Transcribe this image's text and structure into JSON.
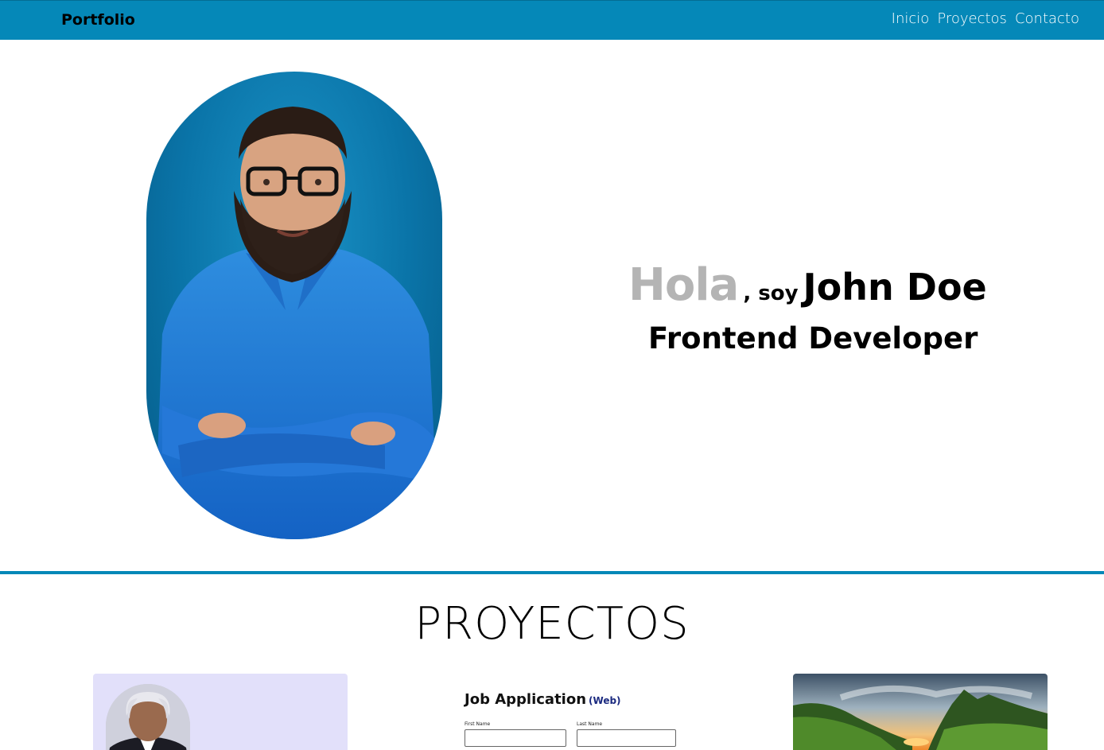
{
  "navbar": {
    "brand": "Portfolio",
    "links": [
      {
        "label": "Inicio"
      },
      {
        "label": "Proyectos"
      },
      {
        "label": "Contacto"
      }
    ]
  },
  "hero": {
    "greeting": "Hola",
    "connector": ", soy",
    "name": "John Doe",
    "role": "Frontend Developer"
  },
  "projects": {
    "title": "PROYECTOS",
    "cards": [
      {
        "kind": "profile-card"
      },
      {
        "title": "Job Application",
        "tag": "(Web)",
        "first_name_label": "First Name",
        "last_name_label": "Last Name"
      },
      {
        "kind": "landscape"
      }
    ]
  },
  "colors": {
    "accent": "#0588b8",
    "greeting_gray": "#b4b4b4",
    "card_lavender": "#e2e0fa"
  }
}
